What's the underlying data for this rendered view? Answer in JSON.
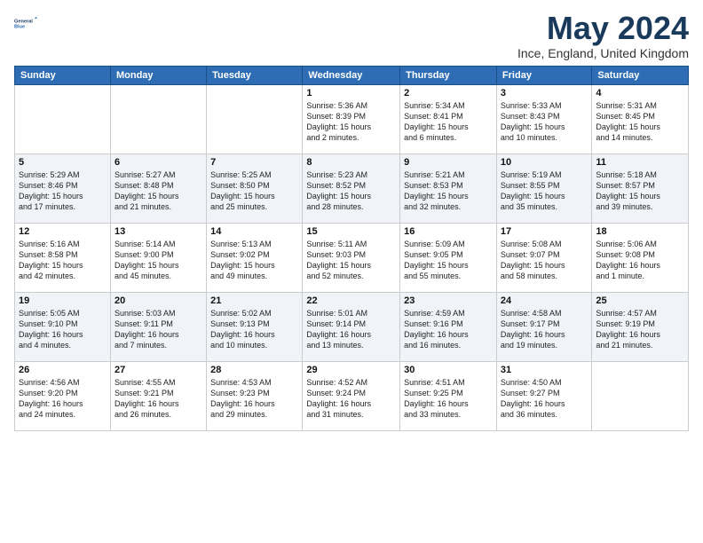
{
  "header": {
    "logo_line1": "General",
    "logo_line2": "Blue",
    "month_title": "May 2024",
    "location": "Ince, England, United Kingdom"
  },
  "days_of_week": [
    "Sunday",
    "Monday",
    "Tuesday",
    "Wednesday",
    "Thursday",
    "Friday",
    "Saturday"
  ],
  "weeks": [
    [
      {
        "day": "",
        "info": ""
      },
      {
        "day": "",
        "info": ""
      },
      {
        "day": "",
        "info": ""
      },
      {
        "day": "1",
        "info": "Sunrise: 5:36 AM\nSunset: 8:39 PM\nDaylight: 15 hours\nand 2 minutes."
      },
      {
        "day": "2",
        "info": "Sunrise: 5:34 AM\nSunset: 8:41 PM\nDaylight: 15 hours\nand 6 minutes."
      },
      {
        "day": "3",
        "info": "Sunrise: 5:33 AM\nSunset: 8:43 PM\nDaylight: 15 hours\nand 10 minutes."
      },
      {
        "day": "4",
        "info": "Sunrise: 5:31 AM\nSunset: 8:45 PM\nDaylight: 15 hours\nand 14 minutes."
      }
    ],
    [
      {
        "day": "5",
        "info": "Sunrise: 5:29 AM\nSunset: 8:46 PM\nDaylight: 15 hours\nand 17 minutes."
      },
      {
        "day": "6",
        "info": "Sunrise: 5:27 AM\nSunset: 8:48 PM\nDaylight: 15 hours\nand 21 minutes."
      },
      {
        "day": "7",
        "info": "Sunrise: 5:25 AM\nSunset: 8:50 PM\nDaylight: 15 hours\nand 25 minutes."
      },
      {
        "day": "8",
        "info": "Sunrise: 5:23 AM\nSunset: 8:52 PM\nDaylight: 15 hours\nand 28 minutes."
      },
      {
        "day": "9",
        "info": "Sunrise: 5:21 AM\nSunset: 8:53 PM\nDaylight: 15 hours\nand 32 minutes."
      },
      {
        "day": "10",
        "info": "Sunrise: 5:19 AM\nSunset: 8:55 PM\nDaylight: 15 hours\nand 35 minutes."
      },
      {
        "day": "11",
        "info": "Sunrise: 5:18 AM\nSunset: 8:57 PM\nDaylight: 15 hours\nand 39 minutes."
      }
    ],
    [
      {
        "day": "12",
        "info": "Sunrise: 5:16 AM\nSunset: 8:58 PM\nDaylight: 15 hours\nand 42 minutes."
      },
      {
        "day": "13",
        "info": "Sunrise: 5:14 AM\nSunset: 9:00 PM\nDaylight: 15 hours\nand 45 minutes."
      },
      {
        "day": "14",
        "info": "Sunrise: 5:13 AM\nSunset: 9:02 PM\nDaylight: 15 hours\nand 49 minutes."
      },
      {
        "day": "15",
        "info": "Sunrise: 5:11 AM\nSunset: 9:03 PM\nDaylight: 15 hours\nand 52 minutes."
      },
      {
        "day": "16",
        "info": "Sunrise: 5:09 AM\nSunset: 9:05 PM\nDaylight: 15 hours\nand 55 minutes."
      },
      {
        "day": "17",
        "info": "Sunrise: 5:08 AM\nSunset: 9:07 PM\nDaylight: 15 hours\nand 58 minutes."
      },
      {
        "day": "18",
        "info": "Sunrise: 5:06 AM\nSunset: 9:08 PM\nDaylight: 16 hours\nand 1 minute."
      }
    ],
    [
      {
        "day": "19",
        "info": "Sunrise: 5:05 AM\nSunset: 9:10 PM\nDaylight: 16 hours\nand 4 minutes."
      },
      {
        "day": "20",
        "info": "Sunrise: 5:03 AM\nSunset: 9:11 PM\nDaylight: 16 hours\nand 7 minutes."
      },
      {
        "day": "21",
        "info": "Sunrise: 5:02 AM\nSunset: 9:13 PM\nDaylight: 16 hours\nand 10 minutes."
      },
      {
        "day": "22",
        "info": "Sunrise: 5:01 AM\nSunset: 9:14 PM\nDaylight: 16 hours\nand 13 minutes."
      },
      {
        "day": "23",
        "info": "Sunrise: 4:59 AM\nSunset: 9:16 PM\nDaylight: 16 hours\nand 16 minutes."
      },
      {
        "day": "24",
        "info": "Sunrise: 4:58 AM\nSunset: 9:17 PM\nDaylight: 16 hours\nand 19 minutes."
      },
      {
        "day": "25",
        "info": "Sunrise: 4:57 AM\nSunset: 9:19 PM\nDaylight: 16 hours\nand 21 minutes."
      }
    ],
    [
      {
        "day": "26",
        "info": "Sunrise: 4:56 AM\nSunset: 9:20 PM\nDaylight: 16 hours\nand 24 minutes."
      },
      {
        "day": "27",
        "info": "Sunrise: 4:55 AM\nSunset: 9:21 PM\nDaylight: 16 hours\nand 26 minutes."
      },
      {
        "day": "28",
        "info": "Sunrise: 4:53 AM\nSunset: 9:23 PM\nDaylight: 16 hours\nand 29 minutes."
      },
      {
        "day": "29",
        "info": "Sunrise: 4:52 AM\nSunset: 9:24 PM\nDaylight: 16 hours\nand 31 minutes."
      },
      {
        "day": "30",
        "info": "Sunrise: 4:51 AM\nSunset: 9:25 PM\nDaylight: 16 hours\nand 33 minutes."
      },
      {
        "day": "31",
        "info": "Sunrise: 4:50 AM\nSunset: 9:27 PM\nDaylight: 16 hours\nand 36 minutes."
      },
      {
        "day": "",
        "info": ""
      }
    ]
  ]
}
